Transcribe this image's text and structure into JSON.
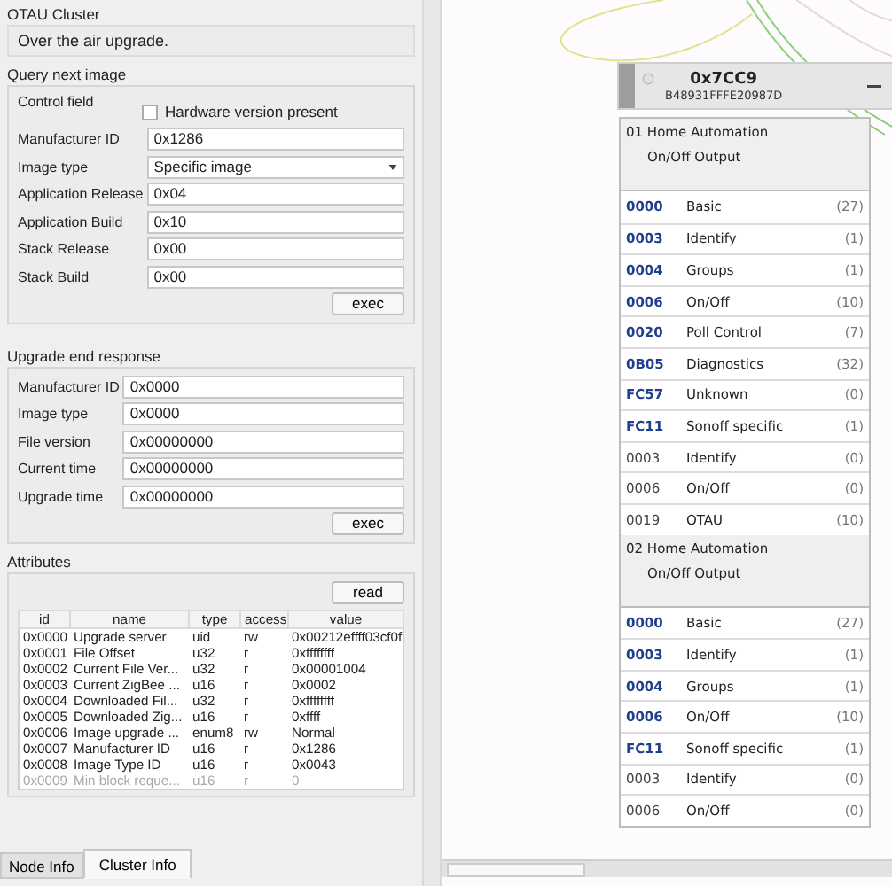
{
  "cluster": {
    "title": "OTAU Cluster",
    "description": "Over the air upgrade."
  },
  "query_next_image": {
    "title": "Query next image",
    "control_field_label": "Control field",
    "hardware_version": {
      "label": "Hardware version present",
      "checked": false
    },
    "fields": [
      {
        "kind": "text",
        "label": "Manufacturer ID",
        "value": "0x1286"
      },
      {
        "kind": "dropdown",
        "label": "Image type",
        "value": "Specific image"
      },
      {
        "kind": "text",
        "label": "Application Release",
        "value": "0x04"
      },
      {
        "kind": "text",
        "label": "Application Build",
        "value": "0x10"
      },
      {
        "kind": "text",
        "label": "Stack Release",
        "value": "0x00"
      },
      {
        "kind": "text",
        "label": "Stack Build",
        "value": "0x00"
      }
    ],
    "button": "exec"
  },
  "upgrade_end_response": {
    "title": "Upgrade end response",
    "fields": [
      {
        "label": "Manufacturer ID",
        "value": "0x0000"
      },
      {
        "label": "Image type",
        "value": "0x0000"
      },
      {
        "label": "File version",
        "value": "0x00000000"
      },
      {
        "label": "Current time",
        "value": "0x00000000"
      },
      {
        "label": "Upgrade time",
        "value": "0x00000000"
      }
    ],
    "button": "exec"
  },
  "attributes": {
    "title": "Attributes",
    "button": "read",
    "columns": [
      "id",
      "name",
      "type",
      "access",
      "value"
    ],
    "rows": [
      {
        "cells": [
          "0x0000",
          "Upgrade server",
          "uid",
          "rw",
          "0x00212effff03cf0f"
        ],
        "disabled": false
      },
      {
        "cells": [
          "0x0001",
          "File Offset",
          "u32",
          "r",
          "0xffffffff"
        ],
        "disabled": false
      },
      {
        "cells": [
          "0x0002",
          "Current File Ver...",
          "u32",
          "r",
          "0x00001004"
        ],
        "disabled": false
      },
      {
        "cells": [
          "0x0003",
          "Current ZigBee ...",
          "u16",
          "r",
          "0x0002"
        ],
        "disabled": false
      },
      {
        "cells": [
          "0x0004",
          "Downloaded Fil...",
          "u32",
          "r",
          "0xffffffff"
        ],
        "disabled": false
      },
      {
        "cells": [
          "0x0005",
          "Downloaded Zig...",
          "u16",
          "r",
          "0xffff"
        ],
        "disabled": false
      },
      {
        "cells": [
          "0x0006",
          "Image upgrade ...",
          "enum8",
          "rw",
          "Normal"
        ],
        "disabled": false
      },
      {
        "cells": [
          "0x0007",
          "Manufacturer ID",
          "u16",
          "r",
          "0x1286"
        ],
        "disabled": false
      },
      {
        "cells": [
          "0x0008",
          "Image Type ID",
          "u16",
          "r",
          "0x0043"
        ],
        "disabled": false
      },
      {
        "cells": [
          "0x0009",
          "Min block reque...",
          "u16",
          "r",
          "0"
        ],
        "disabled": true
      }
    ]
  },
  "tabs": [
    {
      "label": "Node Info",
      "selected": false
    },
    {
      "label": "Cluster Info",
      "selected": true
    }
  ],
  "node": {
    "address": "0x7CC9",
    "mac": "B48931FFFE20987D",
    "endpoints": [
      {
        "title": "01  Home Automation",
        "device": "On/Off Output",
        "clusters": [
          {
            "id": "0000",
            "name": "Basic",
            "count": "(27)",
            "kind": "server"
          },
          {
            "id": "0003",
            "name": "Identify",
            "count": "(1)",
            "kind": "server"
          },
          {
            "id": "0004",
            "name": "Groups",
            "count": "(1)",
            "kind": "server"
          },
          {
            "id": "0006",
            "name": "On/Off",
            "count": "(10)",
            "kind": "server"
          },
          {
            "id": "0020",
            "name": "Poll Control",
            "count": "(7)",
            "kind": "server"
          },
          {
            "id": "0B05",
            "name": "Diagnostics",
            "count": "(32)",
            "kind": "server"
          },
          {
            "id": "FC57",
            "name": "Unknown",
            "count": "(0)",
            "kind": "server"
          },
          {
            "id": "FC11",
            "name": "Sonoff specific",
            "count": "(1)",
            "kind": "server"
          },
          {
            "id": "0003",
            "name": "Identify",
            "count": "(0)",
            "kind": "client"
          },
          {
            "id": "0006",
            "name": "On/Off",
            "count": "(0)",
            "kind": "client"
          },
          {
            "id": "0019",
            "name": "OTAU",
            "count": "(10)",
            "kind": "client"
          }
        ]
      },
      {
        "title": "02  Home Automation",
        "device": "On/Off Output",
        "clusters": [
          {
            "id": "0000",
            "name": "Basic",
            "count": "(27)",
            "kind": "server"
          },
          {
            "id": "0003",
            "name": "Identify",
            "count": "(1)",
            "kind": "server"
          },
          {
            "id": "0004",
            "name": "Groups",
            "count": "(1)",
            "kind": "server"
          },
          {
            "id": "0006",
            "name": "On/Off",
            "count": "(10)",
            "kind": "server"
          },
          {
            "id": "FC11",
            "name": "Sonoff specific",
            "count": "(1)",
            "kind": "server"
          },
          {
            "id": "0003",
            "name": "Identify",
            "count": "(0)",
            "kind": "client"
          },
          {
            "id": "0006",
            "name": "On/Off",
            "count": "(0)",
            "kind": "client"
          }
        ]
      }
    ]
  }
}
